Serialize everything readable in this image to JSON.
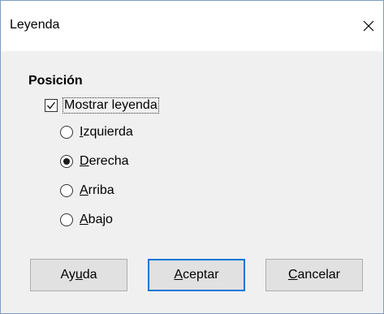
{
  "dialog": {
    "title": "Leyenda",
    "close_icon": "close-icon"
  },
  "position": {
    "section_label": "Posición",
    "show_legend": {
      "label": "Mostrar leyenda",
      "checked": true
    },
    "options": [
      {
        "prefix": "",
        "accel": "I",
        "rest": "zquierda",
        "selected": false
      },
      {
        "prefix": "",
        "accel": "D",
        "rest": "erecha",
        "selected": true
      },
      {
        "prefix": "",
        "accel": "A",
        "rest": "rriba",
        "selected": false
      },
      {
        "prefix": "",
        "accel": "A",
        "rest": "bajo",
        "selected": false
      }
    ]
  },
  "buttons": {
    "help": {
      "prefix": "Ay",
      "accel": "u",
      "rest": "da"
    },
    "ok": {
      "prefix": "",
      "accel": "A",
      "rest": "ceptar"
    },
    "cancel": {
      "prefix": "",
      "accel": "C",
      "rest": "ancelar"
    }
  },
  "colors": {
    "accent": "#0078d7",
    "window_border": "#7a9cc6"
  }
}
